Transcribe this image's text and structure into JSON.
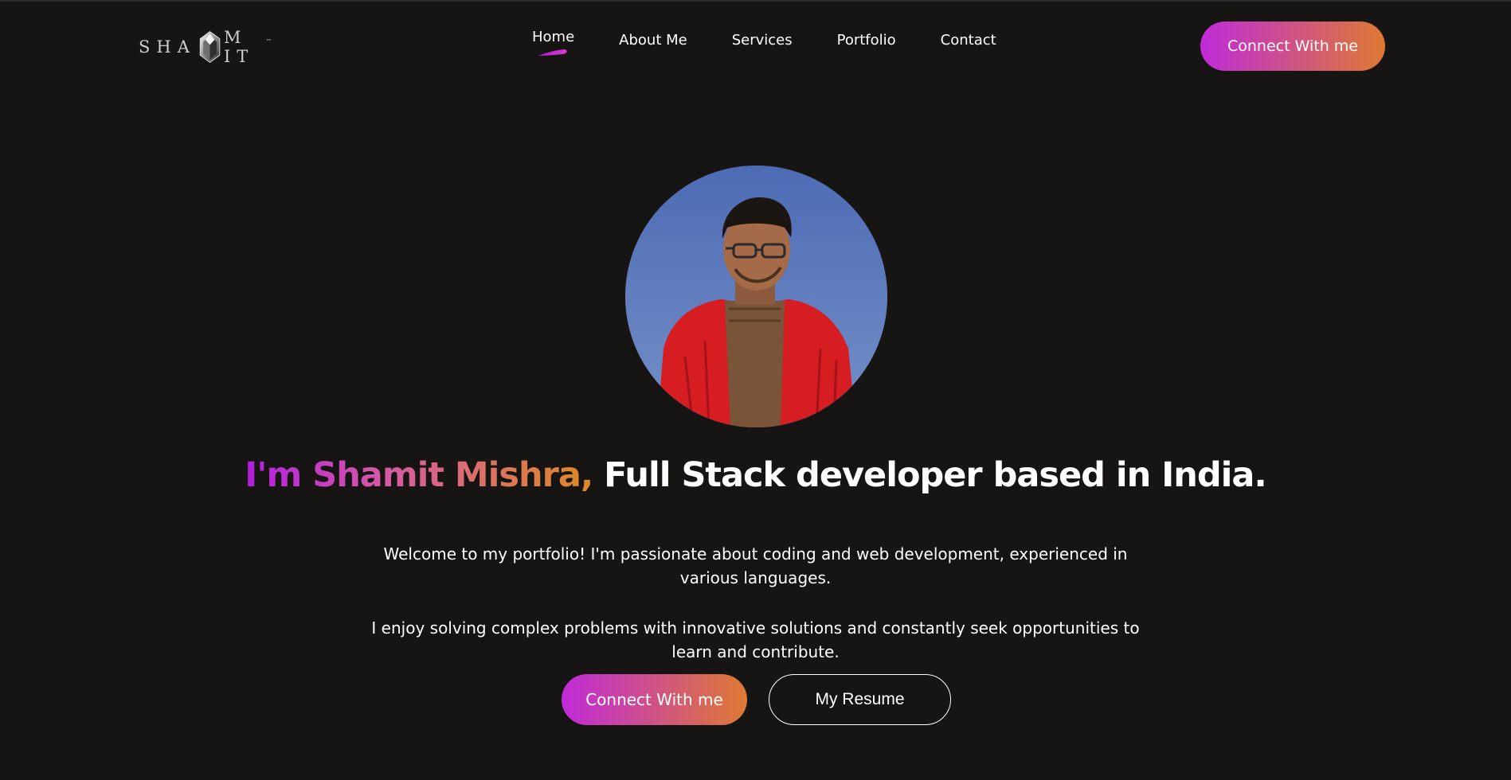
{
  "brand": {
    "logo_prefix": "SHA",
    "logo_suffix": "M IT",
    "trademark": "™"
  },
  "nav": {
    "items": [
      {
        "label": "Home",
        "active": true
      },
      {
        "label": "About Me"
      },
      {
        "label": "Services"
      },
      {
        "label": "Portfolio"
      },
      {
        "label": "Contact"
      }
    ],
    "cta_label": "Connect With me"
  },
  "hero": {
    "headline_gradient": "I'm Shamit Mishra,",
    "headline_rest": "Full Stack developer based in India.",
    "paragraph_1": "Welcome to my portfolio! I'm passionate about coding and web development, experienced in various languages.",
    "paragraph_2": "I enjoy solving complex problems with innovative solutions and constantly seek opportunities to learn and contribute.",
    "primary_button": "Connect With me",
    "secondary_button": "My Resume"
  },
  "colors": {
    "background": "#161513",
    "gradient_start": "#c02bd9",
    "gradient_end": "#de7a32",
    "text": "#ffffff"
  }
}
